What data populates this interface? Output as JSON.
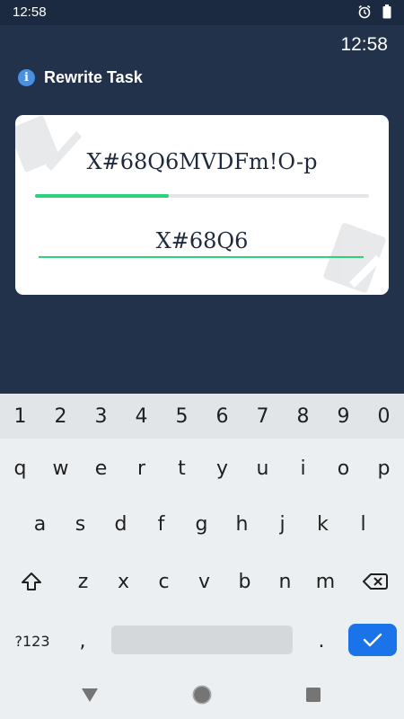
{
  "status_bar": {
    "time": "12:58",
    "icons": [
      "alarm-icon",
      "battery-icon"
    ]
  },
  "clock": "12:58",
  "task": {
    "icon": "info-icon",
    "icon_glyph": "i",
    "title": "Rewrite Task"
  },
  "card": {
    "target_text": "X#68Q6MVDFm!O-p",
    "typed_text": "X#68Q6",
    "progress": 0.4,
    "accent_color": "#2ed27a"
  },
  "keyboard": {
    "number_row": [
      "1",
      "2",
      "3",
      "4",
      "5",
      "6",
      "7",
      "8",
      "9",
      "0"
    ],
    "row1": [
      "q",
      "w",
      "e",
      "r",
      "t",
      "y",
      "u",
      "i",
      "o",
      "p"
    ],
    "row2": [
      "a",
      "s",
      "d",
      "f",
      "g",
      "h",
      "j",
      "k",
      "l"
    ],
    "row3": [
      "z",
      "x",
      "c",
      "v",
      "b",
      "n",
      "m"
    ],
    "symbols_label": "?123",
    "comma": ",",
    "period": ".",
    "enter_color": "#1a73e8"
  },
  "nav": {
    "icons": [
      "back-icon",
      "home-icon",
      "recents-icon"
    ]
  }
}
